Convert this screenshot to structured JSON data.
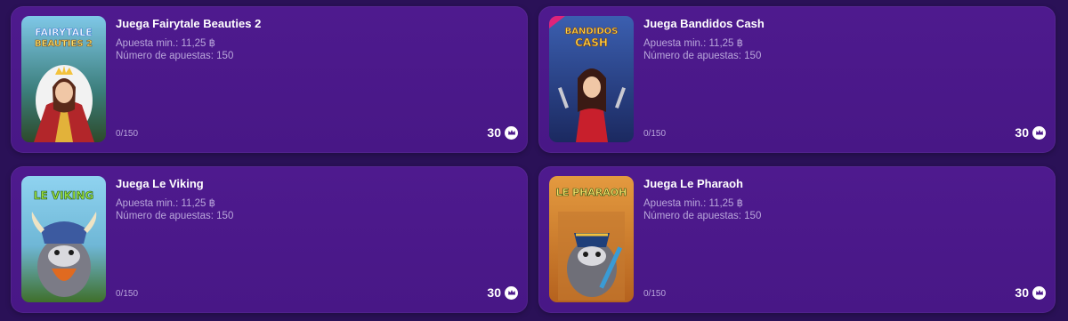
{
  "cards": [
    {
      "title": "Juega Fairytale Beauties 2",
      "min_bet": "Apuesta min.: 11,25 ฿",
      "bet_count": "Número de apuestas: 150",
      "progress": "0/150",
      "reward": "30",
      "game_logo": "FAIRYTALE BEAUTIES 2",
      "thumb_icon": "queen-character-icon"
    },
    {
      "title": "Juega Bandidos Cash",
      "min_bet": "Apuesta min.: 11,25 ฿",
      "bet_count": "Número de apuestas: 150",
      "progress": "0/150",
      "reward": "30",
      "game_logo": "BANDIDOS CASH",
      "thumb_icon": "bandit-woman-character-icon"
    },
    {
      "title": "Juega Le Viking",
      "min_bet": "Apuesta min.: 11,25 ฿",
      "bet_count": "Número de apuestas: 150",
      "progress": "0/150",
      "reward": "30",
      "game_logo": "LE VIKING",
      "thumb_icon": "viking-raccoon-character-icon"
    },
    {
      "title": "Juega Le Pharaoh",
      "min_bet": "Apuesta min.: 11,25 ฿",
      "bet_count": "Número de apuestas: 150",
      "progress": "0/150",
      "reward": "30",
      "game_logo": "LE PHARAOH",
      "thumb_icon": "pharaoh-raccoon-character-icon"
    }
  ],
  "reward_icon": "crown-coin-icon",
  "colors": {
    "page_bg": "#2a1157",
    "card_bg": "#4e1a8e",
    "muted_text": "#b9a6db",
    "title_text": "#ffffff"
  }
}
